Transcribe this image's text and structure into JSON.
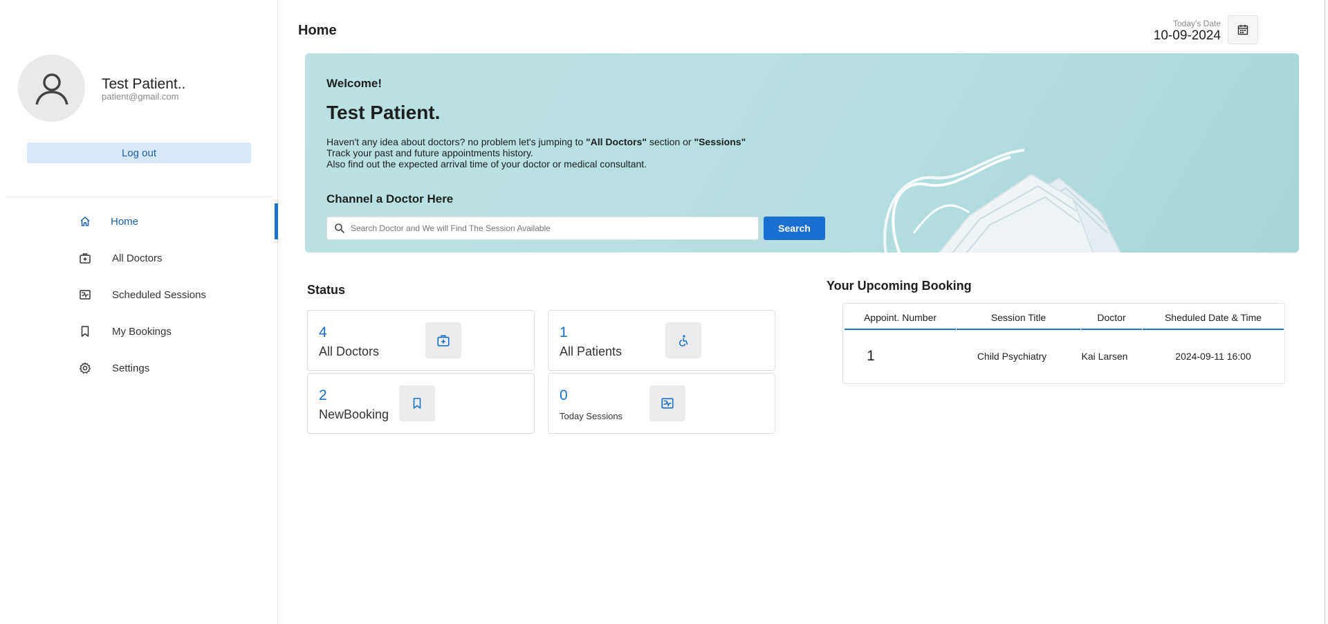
{
  "profile": {
    "name": "Test Patient..",
    "email": "patient@gmail.com",
    "logout_label": "Log out"
  },
  "sidebar": {
    "items": [
      {
        "label": "Home",
        "icon": "home-icon",
        "active": true
      },
      {
        "label": "All Doctors",
        "icon": "doctor-bag-icon",
        "active": false
      },
      {
        "label": "Scheduled Sessions",
        "icon": "schedule-icon",
        "active": false
      },
      {
        "label": "My Bookings",
        "icon": "bookmark-icon",
        "active": false
      },
      {
        "label": "Settings",
        "icon": "gear-icon",
        "active": false
      }
    ]
  },
  "header": {
    "title": "Home",
    "date_caption": "Today's Date",
    "date_value": "10-09-2024"
  },
  "banner": {
    "welcome": "Welcome!",
    "name": "Test Patient.",
    "line1_prefix": "Haven't any idea about doctors? no problem let's jumping to ",
    "line1_bold1": "\"All Doctors\"",
    "line1_mid": " section or ",
    "line1_bold2": "\"Sessions\"",
    "line2": "Track your past and future appointments history.",
    "line3": "Also find out the expected arrival time of your doctor or medical consultant.",
    "channel_title": "Channel a Doctor Here",
    "search_placeholder": "Search Doctor and We will Find The Session Available",
    "search_button": "Search"
  },
  "status": {
    "title": "Status",
    "cards": [
      {
        "value": "4",
        "label": "All Doctors",
        "icon": "doctor-bag-icon"
      },
      {
        "value": "1",
        "label": "All Patients",
        "icon": "accessible-icon"
      },
      {
        "value": "2",
        "label": "NewBooking",
        "icon": "bookmark-icon"
      },
      {
        "value": "0",
        "label": "Today Sessions",
        "icon": "schedule-icon"
      }
    ]
  },
  "bookings": {
    "title": "Your Upcoming Booking",
    "headers": [
      "Appoint. Number",
      "Session Title",
      "Doctor",
      "Sheduled Date & Time"
    ],
    "rows": [
      [
        "1",
        "Child Psychiatry",
        "Kai Larsen",
        "2024-09-11 16:00"
      ]
    ]
  },
  "colors": {
    "accent": "#1a6fc9",
    "banner": "#b5dee0",
    "logout_bg": "#d8e8f8"
  }
}
